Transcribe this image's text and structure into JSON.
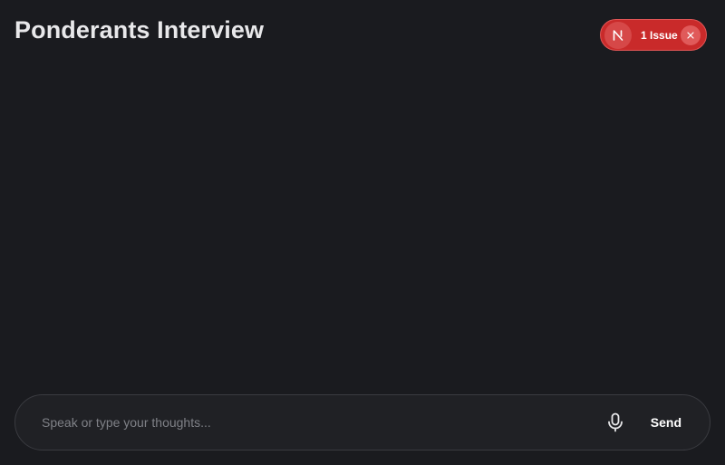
{
  "header": {
    "title": "Ponderants Interview"
  },
  "dev_overlay": {
    "logo_icon": "nextjs-n-icon",
    "issue_label": "1 Issue",
    "close_icon": "close-icon",
    "accent_color": "#c92a2a"
  },
  "composer": {
    "placeholder": "Speak or type your thoughts...",
    "value": "",
    "mic_icon": "microphone-icon",
    "send_label": "Send"
  }
}
